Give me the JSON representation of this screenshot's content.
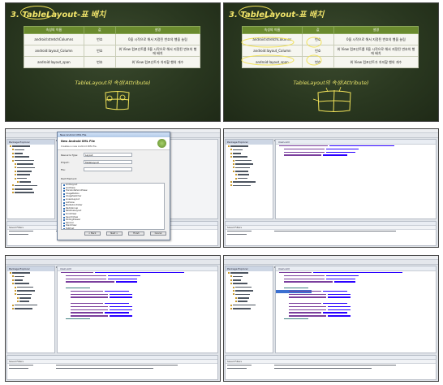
{
  "slides": [
    {
      "title": "3. TableLayout-표 배치",
      "headers": [
        "속성의 이름",
        "값",
        "설명"
      ],
      "rows": [
        [
          "android:stretchColumns",
          "번호",
          "0을 시작으로 해서 지정된 번호의 행을 늘림"
        ],
        [
          "android:layout_Column",
          "번호",
          "위 View 컴포넌트를 0을 시작으로 해서 지정된 번호의 행에 배치"
        ],
        [
          "android:layout_span",
          "번호",
          "위 View 컴포넌트가 차지할 행의 개수"
        ]
      ],
      "subtitle": "TableLayout의 속성(Attribute)"
    },
    {
      "title": "3. TableLayout-표 배치",
      "headers": [
        "속성의 이름",
        "값",
        "설명"
      ],
      "rows": [
        [
          "android:stretchColumns",
          "번호",
          "0을 시작으로 해서 지정된 번호의 행을 늘림"
        ],
        [
          "android:layout_Column",
          "번호",
          "위 View 컴포넌트를 0을 시작으로 해서 지정된 번호의 행에 배치"
        ],
        [
          "android:layout_span",
          "번호",
          "위 View 컴포넌트가 차지할 행의 개수"
        ]
      ],
      "subtitle": "TableLayout의 속성(Attribute)"
    }
  ],
  "dialog": {
    "window_title": "New Android XML File",
    "heading": "New Android XML File",
    "subheading": "Creates a new Android XML file.",
    "resource_type_label": "Resource Type:",
    "resource_type_value": "Layout",
    "project_label": "Project:",
    "project_value": "TableLayout",
    "file_label": "File:",
    "root_element_label": "Root Element:",
    "root_elements": [
      "GridLayout",
      "GridView",
      "HorizontalScrollView",
      "ImageButton",
      "ImageSwitcher",
      "LinearLayout",
      "ListView",
      "MediaController",
      "RadioGroup",
      "RelativeLayout",
      "ScrollView",
      "SearchView",
      "SlidingDrawer",
      "Spinner",
      "StackView",
      "TabHost",
      "TableLayout",
      "TableRow"
    ],
    "selected_index": 16,
    "buttons": [
      "< Back",
      "Next >",
      "Finish",
      "Cancel"
    ]
  },
  "ide": {
    "explorer_title": "Package Explorer",
    "editor_tab": "main.xml",
    "bottom_header": "Saved Filters"
  }
}
